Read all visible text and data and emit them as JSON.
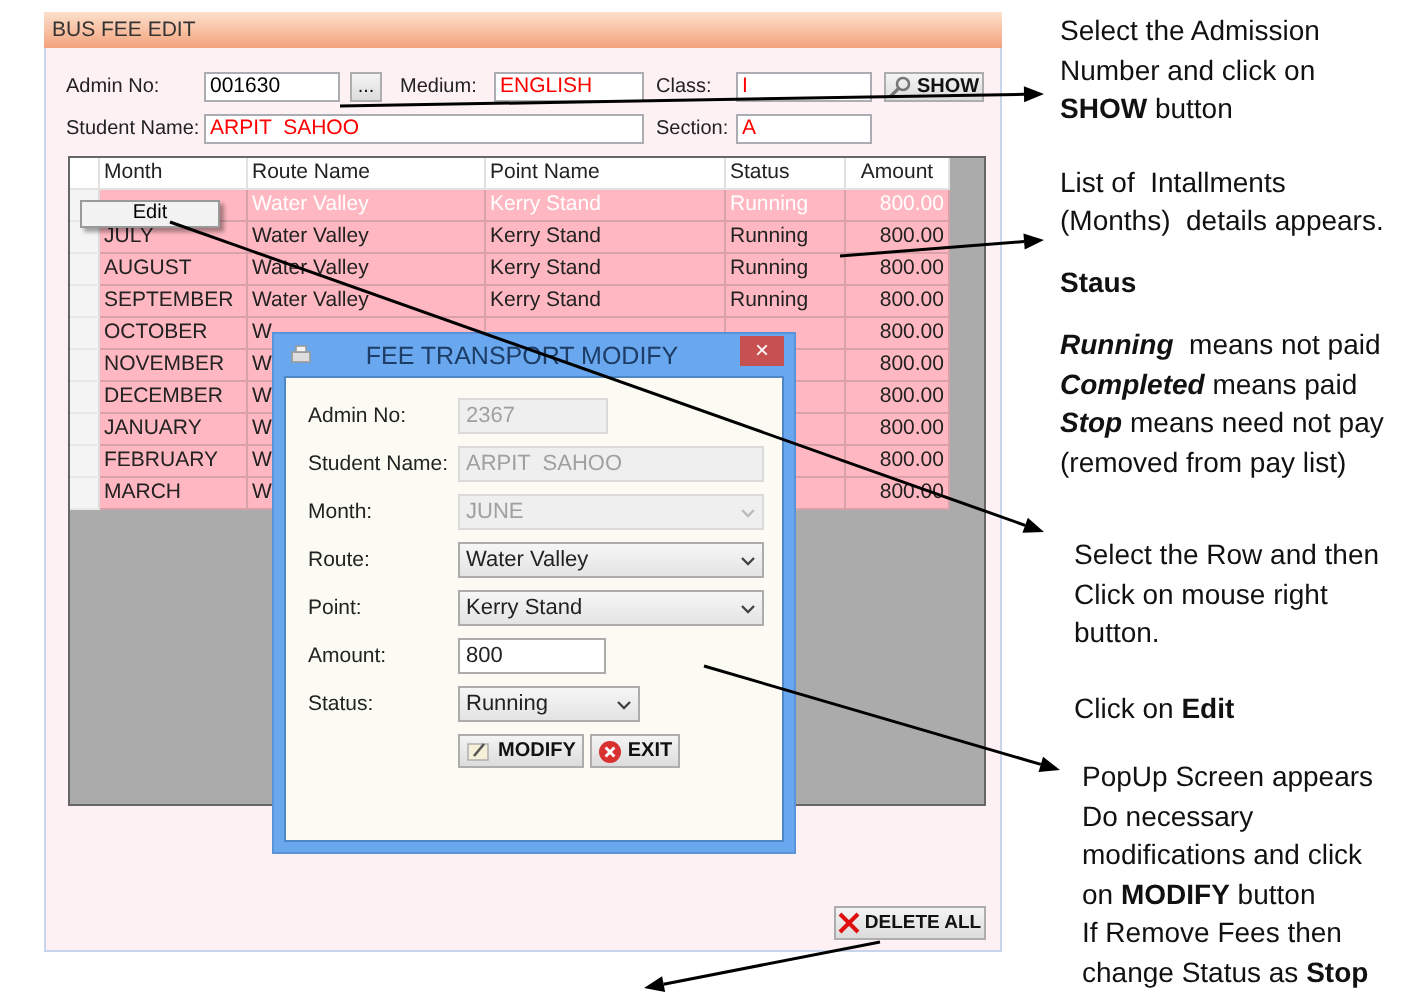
{
  "window": {
    "title": "BUS FEE EDIT",
    "fields": [
      {
        "label": "Admin No:",
        "value": "001630",
        "color": "#000000"
      },
      {
        "label": "Medium:",
        "value": "ENGLISH",
        "color": "#ff0000"
      },
      {
        "label": "Class:",
        "value": "I",
        "color": "#ff0000"
      },
      {
        "label": "Student Name:",
        "value": "ARPIT  SAHOO",
        "color": "#ff0000"
      },
      {
        "label": "Section:",
        "value": "A",
        "color": "#ff0000"
      }
    ],
    "browse_button": "...",
    "show_button": "SHOW",
    "table": {
      "columns": [
        "Month",
        "Route Name",
        "Point Name",
        "Status",
        "Amount"
      ],
      "rows": [
        {
          "selected": true,
          "route": "Water Valley",
          "point": "Kerry Stand",
          "status": "Running",
          "amount": "800.00"
        },
        {
          "selected": false,
          "month": "JULY",
          "route": "Water Valley",
          "point": "Kerry Stand",
          "status": "Running",
          "amount": "800.00"
        },
        {
          "selected": false,
          "month": "AUGUST",
          "route": "Water Valley",
          "point": "Kerry Stand",
          "status": "Running",
          "amount": "800.00"
        },
        {
          "selected": false,
          "month": "SEPTEMBER",
          "route": "Water Valley",
          "point": "Kerry Stand",
          "status": "Running",
          "amount": "800.00"
        },
        {
          "selected": false,
          "month": "OCTOBER",
          "route": "W",
          "amount": "800.00"
        },
        {
          "selected": false,
          "month": "NOVEMBER",
          "route": "W",
          "amount": "800.00"
        },
        {
          "selected": false,
          "month": "DECEMBER",
          "route": "W",
          "amount": "800.00"
        },
        {
          "selected": false,
          "month": "JANUARY",
          "route": "W",
          "amount": "800.00"
        },
        {
          "selected": false,
          "month": "FEBRUARY",
          "route": "W",
          "amount": "800.00"
        },
        {
          "selected": false,
          "month": "MARCH",
          "route": "W",
          "amount": "800.00"
        }
      ]
    },
    "context_menu": {
      "items": [
        "Edit"
      ]
    },
    "delete_button": "DELETE ALL"
  },
  "dialog": {
    "title": "FEE TRANSPORT MODIFY",
    "close_button": "×",
    "fields": [
      {
        "label": "Admin No:",
        "kind": "text",
        "value": "2367",
        "disabled": true
      },
      {
        "label": "Student Name:",
        "kind": "text",
        "value": "ARPIT  SAHOO",
        "disabled": true
      },
      {
        "label": "Month:",
        "kind": "select",
        "value": "JUNE",
        "disabled": true
      },
      {
        "label": "Route:",
        "kind": "select",
        "value": "Water Valley",
        "disabled": false
      },
      {
        "label": "Point:",
        "kind": "select",
        "value": "Kerry Stand",
        "disabled": false
      },
      {
        "label": "Amount:",
        "kind": "text",
        "value": "800",
        "disabled": false
      },
      {
        "label": "Status:",
        "kind": "select",
        "value": "Running",
        "disabled": false
      }
    ],
    "buttons": [
      {
        "kind": "modify",
        "label": "MODIFY"
      },
      {
        "kind": "exit",
        "label": "EXIT"
      }
    ]
  },
  "notes": [
    {
      "kind": "text",
      "lines": [
        "Select the Admission",
        "Number and click on",
        "**SHOW** button"
      ]
    },
    {
      "kind": "text",
      "lines": [
        "List of  Intallments",
        "(Months)  details appears."
      ]
    },
    {
      "kind": "heading",
      "lines": [
        "Staus"
      ]
    },
    {
      "kind": "legend",
      "lines": [
        "**Running**  means not paid",
        "**Completed** means paid",
        "**Stop** means need not pay",
        "(removed from pay list)"
      ]
    },
    {
      "kind": "text",
      "lines": [
        "Select the Row and then",
        "Click on mouse right",
        "button."
      ]
    },
    {
      "kind": "text",
      "lines": [
        "Click on **Edit**"
      ]
    },
    {
      "kind": "text",
      "lines": [
        "PopUp Screen appears",
        "Do necessary",
        "modifications and click",
        "on **MODIFY** button",
        "If Remove Fees then",
        "change Status as **Stop**"
      ]
    }
  ]
}
